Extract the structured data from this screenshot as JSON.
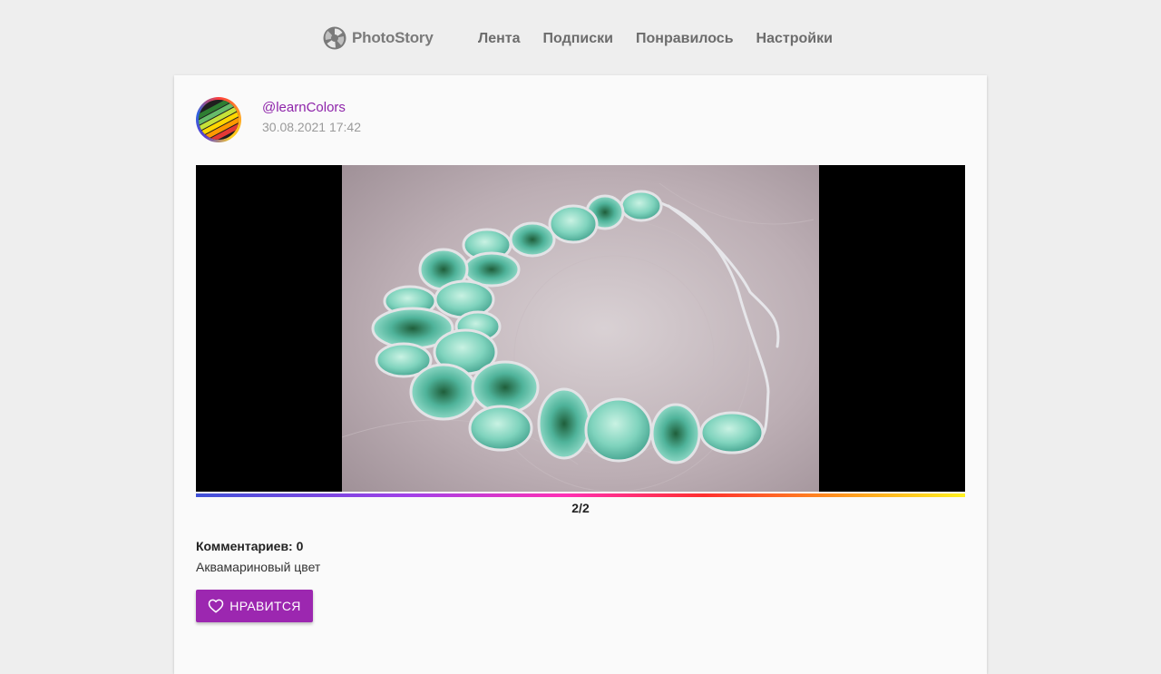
{
  "header": {
    "logo_text": "PhotoStory",
    "logo_icon": "camera-aperture-icon",
    "nav": [
      {
        "label": "Лента"
      },
      {
        "label": "Подписки"
      },
      {
        "label": "Понравилось"
      },
      {
        "label": "Настройки"
      }
    ]
  },
  "post": {
    "username": "@learnColors",
    "datetime": "30.08.2021 17:42",
    "slide_counter": "2/2",
    "comments_label": "Комментариев: 0",
    "caption": "Аквамариновый цвет",
    "like_label": "НРАВИТСЯ",
    "like_icon": "heart-outline-icon"
  },
  "colors": {
    "accent": "#9c27b0",
    "username": "#8e24aa",
    "page_bg": "#eeeeee",
    "card_bg": "#fafafa"
  }
}
